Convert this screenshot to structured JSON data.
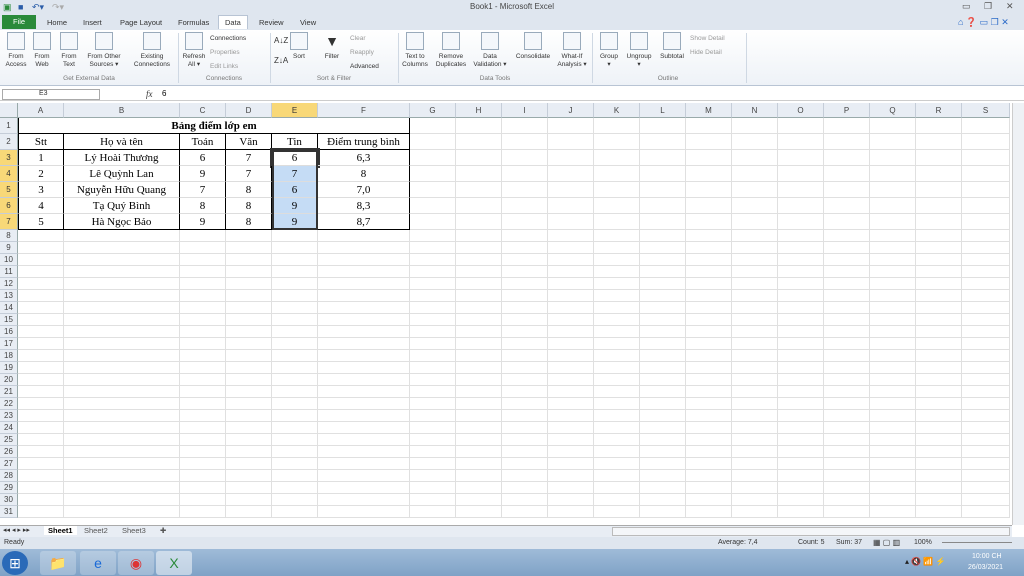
{
  "window": {
    "title": "Book1 - Microsoft Excel"
  },
  "tabs": [
    "File",
    "Home",
    "Insert",
    "Page Layout",
    "Formulas",
    "Data",
    "Review",
    "View"
  ],
  "ribbon": {
    "groups": [
      "Get External Data",
      "Connections",
      "Sort & Filter",
      "Data Tools",
      "Outline"
    ],
    "buttons": [
      "From\nAccess",
      "From\nWeb",
      "From\nText",
      "From Other\nSources ▾",
      "Existing\nConnections",
      "Refresh\nAll ▾",
      "Sort",
      "Filter",
      "Text to\nColumns",
      "Remove\nDuplicates",
      "Data\nValidation ▾",
      "Consolidate",
      "What-If\nAnalysis ▾",
      "Group\n▾",
      "Ungroup\n▾",
      "Subtotal"
    ],
    "small": [
      "Connections",
      "Properties",
      "Edit Links",
      "Clear",
      "Reapply",
      "Advanced",
      "Show Detail",
      "Hide Detail"
    ]
  },
  "formula_bar": {
    "name_box": "E3",
    "fx": "fx",
    "value": "6"
  },
  "columns": [
    "A",
    "B",
    "C",
    "D",
    "E",
    "F",
    "G",
    "H",
    "I",
    "J",
    "K",
    "L",
    "M",
    "N",
    "O",
    "P",
    "Q",
    "R",
    "S"
  ],
  "rows": 31,
  "sheet": {
    "title": "Bảng điểm lớp em",
    "headers": [
      "Stt",
      "Họ và tên",
      "Toán",
      "Văn",
      "Tin",
      "Điểm trung bình"
    ],
    "data": [
      [
        "1",
        "Lý Hoài Thương",
        "6",
        "7",
        "6",
        "6,3"
      ],
      [
        "2",
        "Lê Quỳnh Lan",
        "9",
        "7",
        "7",
        "8"
      ],
      [
        "3",
        "Nguyễn Hữu Quang",
        "7",
        "8",
        "6",
        "7,0"
      ],
      [
        "4",
        "Tạ Quý Bình",
        "8",
        "8",
        "9",
        "8,3"
      ],
      [
        "5",
        "Hà Ngọc Bảo",
        "9",
        "8",
        "9",
        "8,7"
      ]
    ]
  },
  "sheet_tabs": [
    "Sheet1",
    "Sheet2",
    "Sheet3"
  ],
  "status": {
    "ready": "Ready",
    "average": "Average: 7,4",
    "count": "Count: 5",
    "sum": "Sum: 37",
    "zoom": "100%"
  },
  "taskbar": {
    "time": "10:00 CH",
    "date": "26/03/2021"
  },
  "colors": {
    "file_tab": "#2a8a3a",
    "selection": "#c5dcf5",
    "header_highlight": "#f8d878"
  }
}
